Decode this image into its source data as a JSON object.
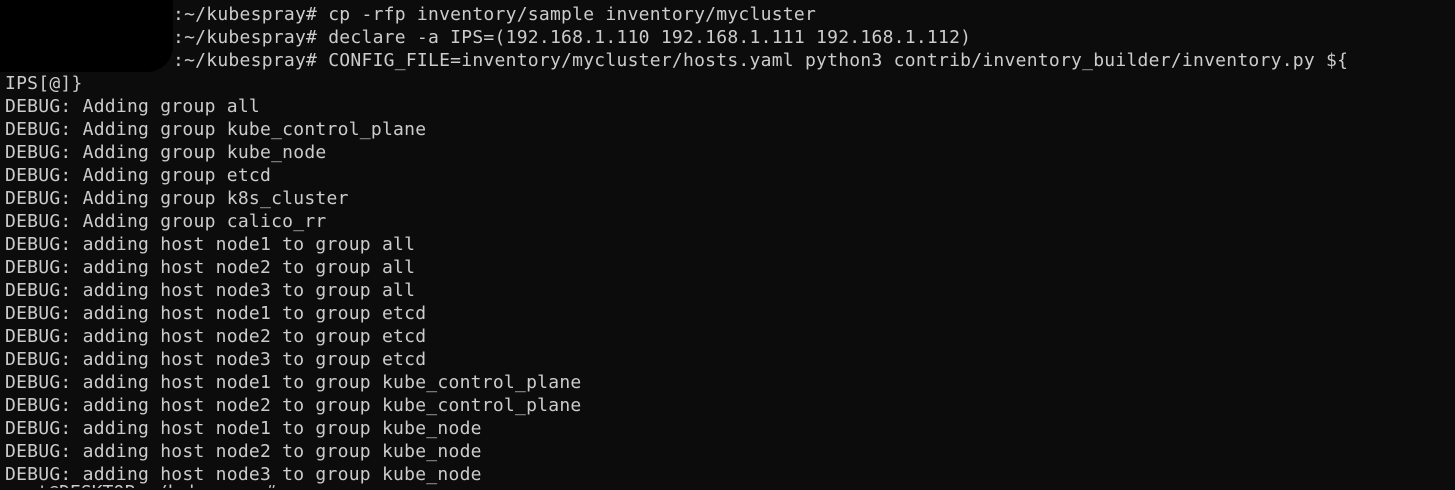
{
  "terminal": {
    "colors": {
      "background": "#0c0c0c",
      "foreground": "#cccccc",
      "redaction": "#000000"
    },
    "prompt_lines": [
      ":~/kubespray# cp -rfp inventory/sample inventory/mycluster",
      ":~/kubespray# declare -a IPS=(192.168.1.110 192.168.1.111 192.168.1.112)",
      ":~/kubespray# CONFIG_FILE=inventory/mycluster/hosts.yaml python3 contrib/inventory_builder/inventory.py ${"
    ],
    "wrapped_line": "IPS[@]}",
    "output_lines": [
      "DEBUG: Adding group all",
      "DEBUG: Adding group kube_control_plane",
      "DEBUG: Adding group kube_node",
      "DEBUG: Adding group etcd",
      "DEBUG: Adding group k8s_cluster",
      "DEBUG: Adding group calico_rr",
      "DEBUG: adding host node1 to group all",
      "DEBUG: adding host node2 to group all",
      "DEBUG: adding host node3 to group all",
      "DEBUG: adding host node1 to group etcd",
      "DEBUG: adding host node2 to group etcd",
      "DEBUG: adding host node3 to group etcd",
      "DEBUG: adding host node1 to group kube_control_plane",
      "DEBUG: adding host node2 to group kube_control_plane",
      "DEBUG: adding host node1 to group kube_node",
      "DEBUG: adding host node2 to group kube_node",
      "DEBUG: adding host node3 to group kube_node"
    ],
    "cut_off_line": "root@DESKTOP:~/kubespray#"
  }
}
